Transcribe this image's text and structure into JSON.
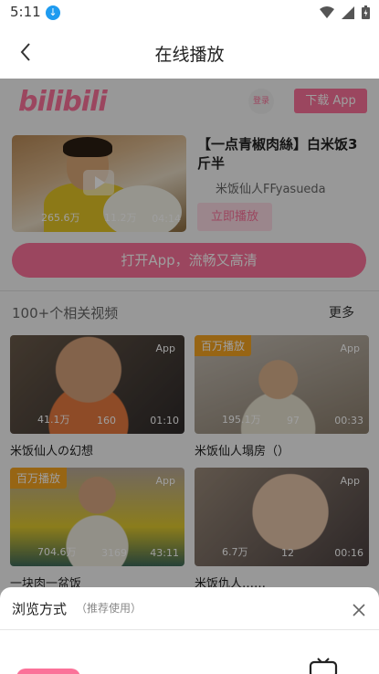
{
  "status_bar": {
    "time": "5:11",
    "icons": [
      "download-icon",
      "wifi-icon",
      "signal-icon",
      "battery-icon"
    ]
  },
  "header": {
    "title": "在线播放"
  },
  "brand": {
    "logo": "bilibili",
    "login": "登录",
    "download": "下载 App",
    "accent": "#fb7299"
  },
  "main_video": {
    "title": "【一点青椒肉絲】白米饭3斤半",
    "uploader": "米饭仙人FFyasueda",
    "views": "265.6万",
    "danmaku": "11.2万",
    "duration": "04:14",
    "play_button": "立即播放"
  },
  "open_app": "打开App，流畅又高清",
  "related": {
    "heading": "100+个相关视频",
    "more": "更多",
    "items": [
      {
        "title": "米饭仙人の幻想",
        "views": "41.1万",
        "danmaku": "160",
        "duration": "01:10",
        "tag": "App",
        "badge": ""
      },
      {
        "title": "米饭仙人塌房（）",
        "views": "195.1万",
        "danmaku": "97",
        "duration": "00:33",
        "tag": "App",
        "badge": "百万播放"
      },
      {
        "title": "一块肉一盆饭",
        "views": "704.6万",
        "danmaku": "3169",
        "duration": "43:11",
        "tag": "App",
        "badge": "百万播放"
      },
      {
        "title": "米饭仇人……",
        "views": "6.7万",
        "danmaku": "12",
        "duration": "00:16",
        "tag": "App",
        "badge": ""
      }
    ]
  },
  "sheet": {
    "title": "浏览方式",
    "hint": "（推荐使用）"
  }
}
